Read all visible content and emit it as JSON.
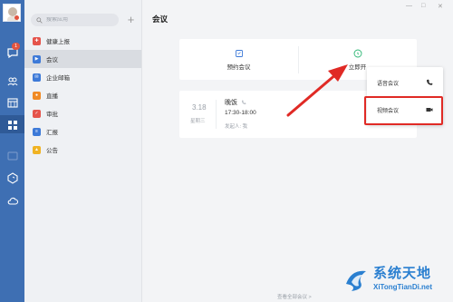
{
  "sidebar": {
    "search_placeholder": "搜索应用",
    "add_symbol": "+",
    "items": [
      {
        "label": "健康上报",
        "color": "#e5544b",
        "icon": "health-report-icon"
      },
      {
        "label": "会议",
        "color": "#3d7ad8",
        "icon": "meeting-icon"
      },
      {
        "label": "企业邮箱",
        "color": "#3d7ad8",
        "icon": "mail-icon"
      },
      {
        "label": "直播",
        "color": "#f08a24",
        "icon": "live-icon"
      },
      {
        "label": "审批",
        "color": "#e5544b",
        "icon": "approval-icon"
      },
      {
        "label": "汇报",
        "color": "#3d7ad8",
        "icon": "report-icon"
      },
      {
        "label": "公告",
        "color": "#f0b323",
        "icon": "announcement-icon"
      }
    ]
  },
  "rail": {
    "badge": "1"
  },
  "main": {
    "title": "会议",
    "window_minimize": "—",
    "window_maximize": "□",
    "window_close": "✕",
    "actions": {
      "schedule_label": "预约会议",
      "start_now_label": "立即开"
    },
    "meeting": {
      "date": "3.18",
      "weekday": "星期三",
      "title": "晚饭",
      "time": "17:30-18:00",
      "host": "发起人: 我"
    },
    "footer_link": "查看全部会议 >"
  },
  "dropdown": {
    "voice_label": "语音会议",
    "video_label": "视频会议"
  },
  "watermark": {
    "title": "系统天地",
    "subtitle": "XiTongTianDi.net"
  },
  "colors": {
    "rail": "#3e6fb3",
    "accent_red": "#e02a25",
    "watermark_blue": "#2a7fd0"
  }
}
